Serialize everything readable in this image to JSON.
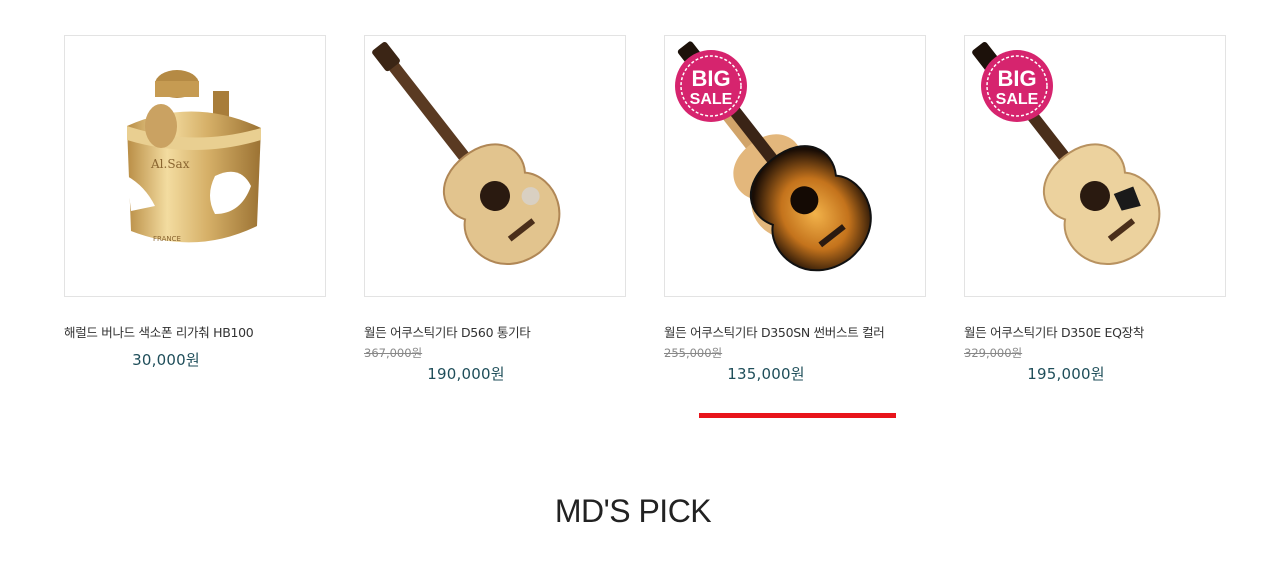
{
  "products": [
    {
      "name": "해럴드 버나드 색소폰 리가춰 HB100",
      "old_price": "",
      "price": "30,000원",
      "badge": ""
    },
    {
      "name": "월든 어쿠스틱기타 D560 통기타",
      "old_price": "367,000원",
      "price": "190,000원",
      "badge": ""
    },
    {
      "name": "월든 어쿠스틱기타 D350SN 썬버스트 컬러",
      "old_price": "255,000원",
      "price": "135,000원",
      "badge_top": "BIG",
      "badge_bottom": "SALE"
    },
    {
      "name": "월든 어쿠스틱기타 D350E EQ장착",
      "old_price": "329,000원",
      "price": "195,000원",
      "badge_top": "BIG",
      "badge_bottom": "SALE"
    }
  ],
  "section_title": "MD'S PICK",
  "colors": {
    "price": "#1f4e5a",
    "highlight_bar": "#e8141b",
    "badge": "#d6246e"
  }
}
